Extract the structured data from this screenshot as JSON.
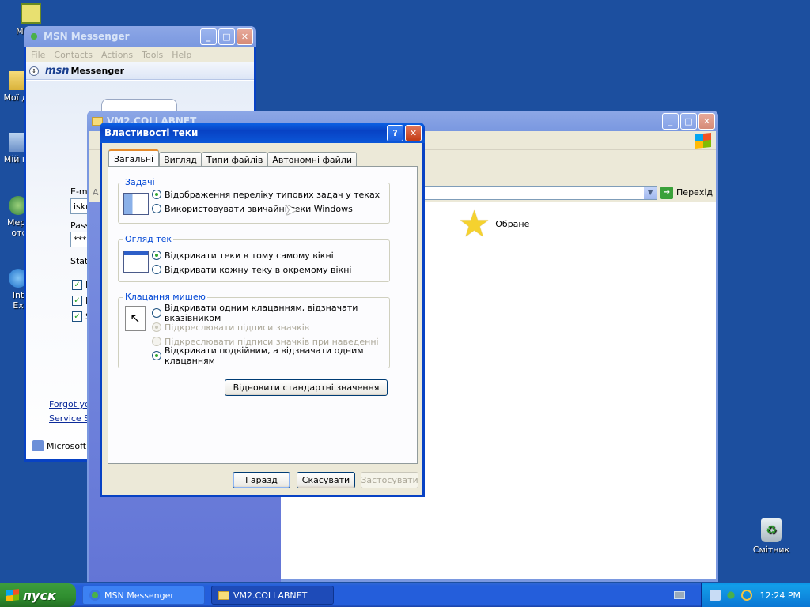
{
  "desktop": {
    "icons": [
      {
        "label": "Mic Ou",
        "icon": "outlook-icon"
      },
      {
        "label": "Мої до",
        "icon": "my-documents-icon"
      },
      {
        "label": "Мій ко",
        "icon": "my-computer-icon"
      },
      {
        "label": "Мере отс",
        "icon": "network-icon"
      },
      {
        "label": "Int Ex",
        "icon": "internet-explorer-icon"
      },
      {
        "label": "Смітник",
        "icon": "recycle-bin-icon"
      }
    ]
  },
  "msn": {
    "title": "MSN Messenger",
    "menu": [
      "File",
      "Contacts",
      "Actions",
      "Tools",
      "Help"
    ],
    "brand": "msn",
    "brand_suffix": "Messenger",
    "email_label": "E-ma",
    "email_value": "iskr",
    "password_label": "Pass",
    "password_value": "***",
    "status_label": "Stat",
    "check_labels": [
      "R",
      "R",
      "S"
    ],
    "links": [
      "Forgot yo",
      "Service St"
    ],
    "footer": "Microsoft"
  },
  "explorer": {
    "title": "VM2.COLLABNET",
    "address_prefix": "А",
    "go_label": "Перехід",
    "favorite_label": "Обране"
  },
  "dialog": {
    "title": "Властивості теки",
    "tabs": [
      "Загальні",
      "Вигляд",
      "Типи файлів",
      "Автономні файли"
    ],
    "active_tab": 0,
    "groups": {
      "tasks": {
        "legend": "Задачі",
        "options": [
          "Відображення переліку типових задач у теках",
          "Використовувати звичайні теки Windows"
        ],
        "selected": 0
      },
      "browse": {
        "legend": "Огляд тек",
        "options": [
          "Відкривати теки в тому самому вікні",
          "Відкривати кожну теку в окремому вікні"
        ],
        "selected": 0
      },
      "click": {
        "legend": "Клацання мишею",
        "options": [
          "Відкривати одним клацанням, відзначати вказівником",
          "Підкреслювати підписи значків",
          "Підкреслювати підписи значків при наведенні",
          "Відкривати подвійним, а відзначати одним клацанням"
        ],
        "selected": 3,
        "sub_selected": 1,
        "disabled": [
          1,
          2
        ]
      }
    },
    "restore_label": "Відновити стандартні значення",
    "ok_label": "Гаразд",
    "cancel_label": "Скасувати",
    "apply_label": "Застосувати"
  },
  "taskbar": {
    "start_label": "пуск",
    "tasks": [
      {
        "label": "MSN Messenger",
        "icon": "msn-icon"
      },
      {
        "label": "VM2.COLLABNET",
        "icon": "folder-icon"
      }
    ],
    "clock": "12:24 PM"
  },
  "colors": {
    "desktop": "#1c4f9f",
    "titlebar_active": "#0842c4",
    "dialog_bg": "#ece9d8",
    "group_legend": "#0046d5"
  }
}
